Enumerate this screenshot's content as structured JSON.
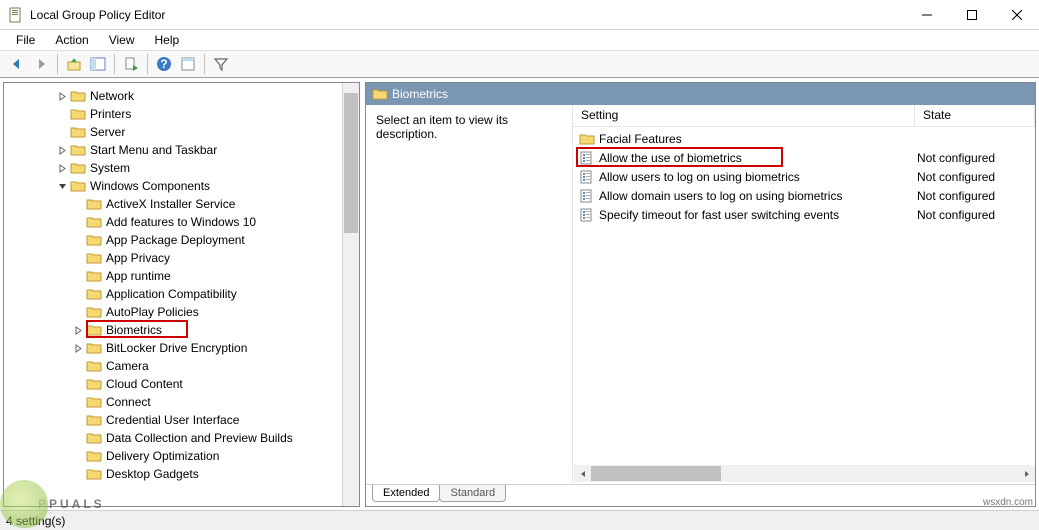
{
  "window": {
    "title": "Local Group Policy Editor"
  },
  "menus": {
    "file": "File",
    "action": "Action",
    "view": "View",
    "help": "Help"
  },
  "tree": {
    "items": [
      {
        "label": "Network",
        "indent": 3,
        "exp": "closed"
      },
      {
        "label": "Printers",
        "indent": 3,
        "exp": ""
      },
      {
        "label": "Server",
        "indent": 3,
        "exp": ""
      },
      {
        "label": "Start Menu and Taskbar",
        "indent": 3,
        "exp": "closed"
      },
      {
        "label": "System",
        "indent": 3,
        "exp": "closed"
      },
      {
        "label": "Windows Components",
        "indent": 3,
        "exp": "open"
      },
      {
        "label": "ActiveX Installer Service",
        "indent": 4,
        "exp": ""
      },
      {
        "label": "Add features to Windows 10",
        "indent": 4,
        "exp": ""
      },
      {
        "label": "App Package Deployment",
        "indent": 4,
        "exp": ""
      },
      {
        "label": "App Privacy",
        "indent": 4,
        "exp": ""
      },
      {
        "label": "App runtime",
        "indent": 4,
        "exp": ""
      },
      {
        "label": "Application Compatibility",
        "indent": 4,
        "exp": ""
      },
      {
        "label": "AutoPlay Policies",
        "indent": 4,
        "exp": ""
      },
      {
        "label": "Biometrics",
        "indent": 4,
        "exp": "closed",
        "highlight": true
      },
      {
        "label": "BitLocker Drive Encryption",
        "indent": 4,
        "exp": "closed"
      },
      {
        "label": "Camera",
        "indent": 4,
        "exp": ""
      },
      {
        "label": "Cloud Content",
        "indent": 4,
        "exp": ""
      },
      {
        "label": "Connect",
        "indent": 4,
        "exp": ""
      },
      {
        "label": "Credential User Interface",
        "indent": 4,
        "exp": ""
      },
      {
        "label": "Data Collection and Preview Builds",
        "indent": 4,
        "exp": ""
      },
      {
        "label": "Delivery Optimization",
        "indent": 4,
        "exp": ""
      },
      {
        "label": "Desktop Gadgets",
        "indent": 4,
        "exp": ""
      }
    ]
  },
  "right": {
    "header": "Biometrics",
    "description_prompt": "Select an item to view its description.",
    "columns": {
      "setting": "Setting",
      "state": "State"
    },
    "rows": [
      {
        "icon": "folder",
        "setting": "Facial Features",
        "state": ""
      },
      {
        "icon": "policy",
        "setting": "Allow the use of biometrics",
        "state": "Not configured",
        "highlight": true
      },
      {
        "icon": "policy",
        "setting": "Allow users to log on using biometrics",
        "state": "Not configured"
      },
      {
        "icon": "policy",
        "setting": "Allow domain users to log on using biometrics",
        "state": "Not configured"
      },
      {
        "icon": "policy",
        "setting": "Specify timeout for fast user switching events",
        "state": "Not configured"
      }
    ],
    "tabs": {
      "extended": "Extended",
      "standard": "Standard"
    }
  },
  "status": {
    "text": "4 setting(s)"
  },
  "watermark": "PPUALS",
  "source_tag": "wsxdn.com"
}
